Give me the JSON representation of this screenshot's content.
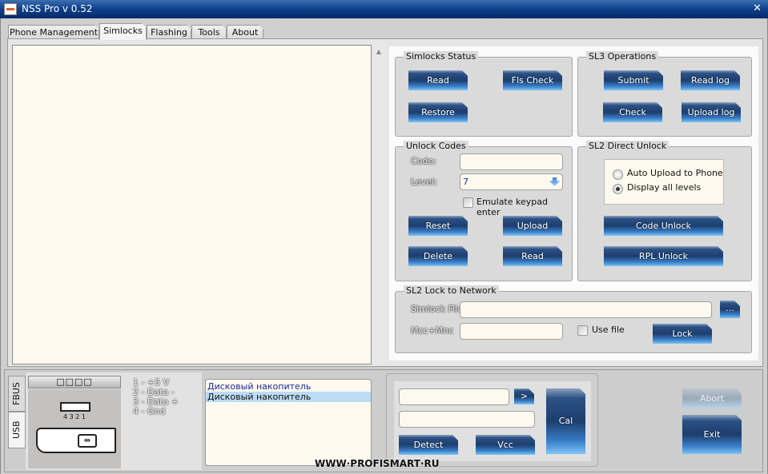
{
  "window": {
    "title": "NSS Pro v 0.52",
    "close": "✕"
  },
  "tabs": [
    {
      "label": "Phone Management"
    },
    {
      "label": "Simlocks",
      "active": true
    },
    {
      "label": "Flashing"
    },
    {
      "label": "Tools"
    },
    {
      "label": "About"
    }
  ],
  "simlocks_status": {
    "title": "Simlocks Status",
    "read": "Read",
    "fls_check": "Fls Check",
    "restore": "Restore"
  },
  "sl3": {
    "title": "SL3 Operations",
    "submit": "Submit",
    "read_log": "Read log",
    "check": "Check",
    "upload_log": "Upload log"
  },
  "unlock_codes": {
    "title": "Unlock Codes",
    "code_label": "Code:",
    "code_value": "",
    "level_label": "Level:",
    "level_value": "7",
    "emulate_label": "Emulate keypad enter",
    "emulate_checked": false,
    "reset": "Reset",
    "upload": "Upload",
    "delete": "Delete",
    "read": "Read"
  },
  "sl2_direct": {
    "title": "SL2 Direct Unlock",
    "radio_auto": "Auto Upload to Phone",
    "radio_display": "Display all levels",
    "selected": "Display all levels",
    "code_unlock": "Code Unlock",
    "rpl_unlock": "RPL Unlock"
  },
  "sl2_lock": {
    "title": "SL2 Lock to Network",
    "simlock_file_label": "Simlock File",
    "simlock_file_value": "",
    "browse": "...",
    "mcc_label": "Mcc+Mnc",
    "mcc_value": "",
    "use_file_label": "Use file",
    "use_file_checked": false,
    "lock": "Lock"
  },
  "connection": {
    "tabs": [
      {
        "label": "FBUS"
      },
      {
        "label": "USB",
        "active": true
      }
    ],
    "port_indicator": "□□□□",
    "pin_numbers": "4 3 2 1",
    "pinout": [
      "1 - +5 V",
      "2 - Data -",
      "3 - Data +",
      "4 - Gnd"
    ],
    "devices": [
      "Дисковый накопитель",
      "Дисковый накопитель"
    ],
    "selected_device_index": 1
  },
  "controls": {
    "combo1": "",
    "next": ">",
    "combo2": "",
    "detect": "Detect",
    "vcc": "Vcc",
    "cal": "Cal",
    "abort": "Abort",
    "exit": "Exit"
  },
  "watermark": "WWW·PROFISMART·RU",
  "colors": {
    "accent": "#1d3e6e",
    "button_light": "#7cc4f6",
    "field": "#fdf9ee",
    "selection": "#bcdcf4"
  }
}
